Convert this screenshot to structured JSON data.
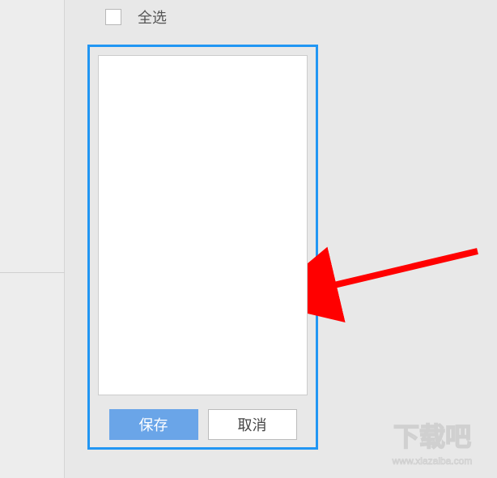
{
  "checkbox": {
    "label": "全选",
    "checked": false
  },
  "editor": {
    "value": ""
  },
  "buttons": {
    "save_label": "保存",
    "cancel_label": "取消"
  },
  "watermark": {
    "text_main": "下载吧",
    "text_sub": "www.xiazaiba.com"
  }
}
